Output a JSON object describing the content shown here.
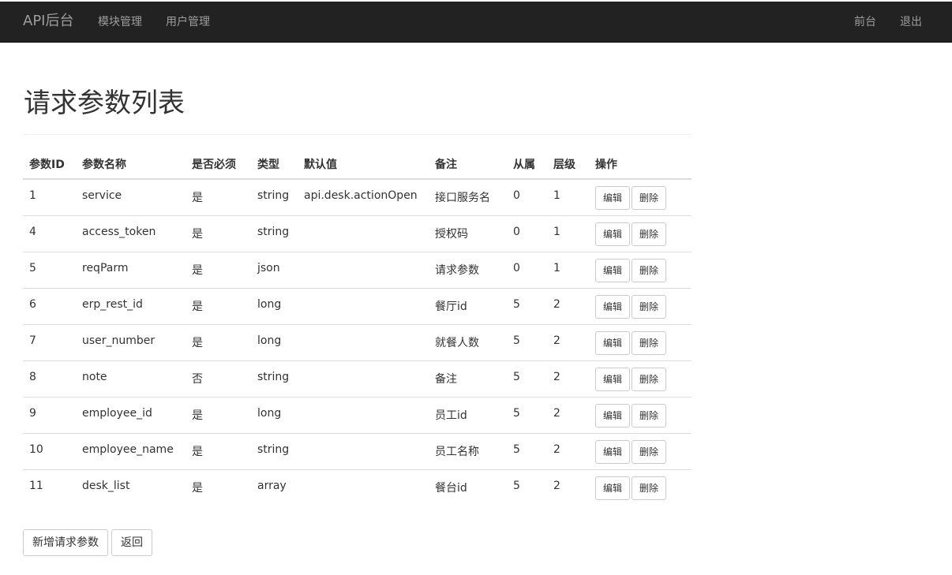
{
  "navbar": {
    "brand": "API后台",
    "left_links": [
      "模块管理",
      "用户管理"
    ],
    "right_links": [
      "前台",
      "退出"
    ]
  },
  "page": {
    "title": "请求参数列表"
  },
  "table": {
    "headers": [
      "参数ID",
      "参数名称",
      "是否必须",
      "类型",
      "默认值",
      "备注",
      "从属",
      "层级",
      "操作"
    ],
    "rows": [
      {
        "id": "1",
        "name": "service",
        "required": "是",
        "type": "string",
        "default": "api.desk.actionOpen",
        "note": "接口服务名",
        "parent": "0",
        "level": "1"
      },
      {
        "id": "4",
        "name": "access_token",
        "required": "是",
        "type": "string",
        "default": "",
        "note": "授权码",
        "parent": "0",
        "level": "1"
      },
      {
        "id": "5",
        "name": "reqParm",
        "required": "是",
        "type": "json",
        "default": "",
        "note": "请求参数",
        "parent": "0",
        "level": "1"
      },
      {
        "id": "6",
        "name": "erp_rest_id",
        "required": "是",
        "type": "long",
        "default": "",
        "note": "餐厅id",
        "parent": "5",
        "level": "2"
      },
      {
        "id": "7",
        "name": "user_number",
        "required": "是",
        "type": "long",
        "default": "",
        "note": "就餐人数",
        "parent": "5",
        "level": "2"
      },
      {
        "id": "8",
        "name": "note",
        "required": "否",
        "type": "string",
        "default": "",
        "note": "备注",
        "parent": "5",
        "level": "2"
      },
      {
        "id": "9",
        "name": "employee_id",
        "required": "是",
        "type": "long",
        "default": "",
        "note": "员工id",
        "parent": "5",
        "level": "2"
      },
      {
        "id": "10",
        "name": "employee_name",
        "required": "是",
        "type": "string",
        "default": "",
        "note": "员工名称",
        "parent": "5",
        "level": "2"
      },
      {
        "id": "11",
        "name": "desk_list",
        "required": "是",
        "type": "array",
        "default": "",
        "note": "餐台id",
        "parent": "5",
        "level": "2"
      }
    ],
    "edit_label": "编辑",
    "delete_label": "删除"
  },
  "actions": {
    "add_label": "新增请求参数",
    "back_label": "返回"
  }
}
